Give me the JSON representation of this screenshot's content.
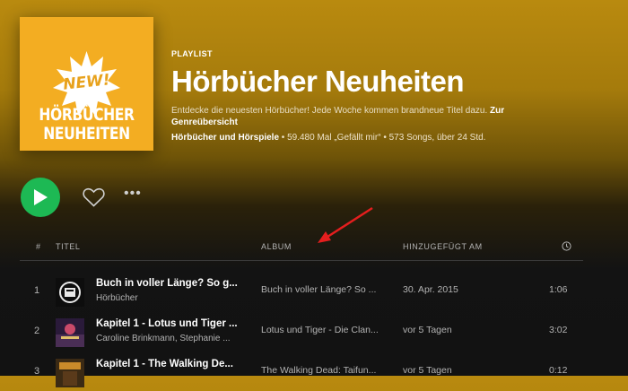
{
  "playlist": {
    "type_label": "PLAYLIST",
    "title": "Hörbücher Neuheiten",
    "description": "Entdecke die neuesten Hörbücher! Jede Woche kommen brandneue Titel dazu.",
    "description_link": "Zur Genreübersicht",
    "owner": "Hörbücher und Hörspiele",
    "stats": " • 59.480 Mal „Gefällt mir“ • 573 Songs, über 24 Std."
  },
  "cover": {
    "badge": "NEW!",
    "line1": "HÖRBÜCHER",
    "line2": "NEUHEITEN",
    "background": "#f3ad22"
  },
  "controls": {
    "play_icon": "play-icon",
    "like_icon": "heart-icon",
    "more_label": "•••",
    "accent": "#1db954"
  },
  "table": {
    "headers": {
      "num": "#",
      "title": "TITEL",
      "album": "ALBUM",
      "added": "HINZUGEFÜGT AM",
      "duration_icon": "clock-icon"
    },
    "rows": [
      {
        "num": "1",
        "title": "Buch in voller Länge? So g...",
        "artist": "Hörbücher",
        "album": "Buch in voller Länge? So ...",
        "added": "30. Apr. 2015",
        "duration": "1:06"
      },
      {
        "num": "2",
        "title": "Kapitel 1 - Lotus und Tiger ...",
        "artist": "Caroline Brinkmann, Stephanie ...",
        "album": "Lotus und Tiger - Die Clan...",
        "added": "vor 5 Tagen",
        "duration": "3:02"
      },
      {
        "num": "3",
        "title": "Kapitel 1 - The Walking De...",
        "artist": "",
        "album": "The Walking Dead: Taifun...",
        "added": "vor 5 Tagen",
        "duration": "0:12"
      }
    ]
  },
  "annotation": {
    "arrow_color": "#e41e1e"
  }
}
